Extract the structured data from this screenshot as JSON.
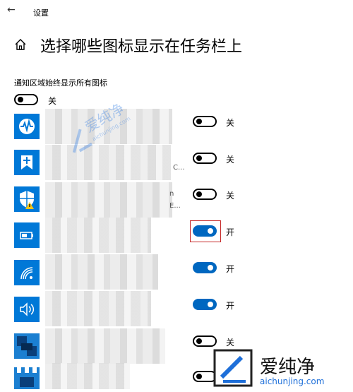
{
  "window": {
    "title": "设置",
    "back_icon": "back-arrow-icon"
  },
  "page": {
    "title": "选择哪些图标显示在任务栏上",
    "home_icon": "home-icon"
  },
  "always_show": {
    "label": "通知区域始终显示所有图标",
    "state": "关"
  },
  "apps": [
    {
      "icon": "activity-pulse-icon",
      "icon_color": "#0078d7",
      "state": "关",
      "on": false
    },
    {
      "icon": "bookmark-shield-icon",
      "icon_color": "#0078d7",
      "tail_text": "C...",
      "state": "关",
      "on": false
    },
    {
      "icon": "security-shield-warning-icon",
      "icon_color": "#0078d7",
      "tail_text": "n\nE...",
      "state": "关",
      "on": false
    },
    {
      "icon": "battery-icon",
      "icon_color": "#0078d7",
      "state": "开",
      "on": true
    },
    {
      "icon": "wifi-icon",
      "icon_color": "#0078d7",
      "state": "开",
      "on": true
    },
    {
      "icon": "volume-icon",
      "icon_color": "#0078d7",
      "state": "开",
      "on": true
    },
    {
      "icon": "app-tile-icon",
      "icon_color": "#0a5fa8",
      "state": "关",
      "on": false
    },
    {
      "icon": "app-tile-icon",
      "icon_color": "#0a5fa8",
      "state": "",
      "on": false
    }
  ],
  "watermark": {
    "name": "爱纯净",
    "url": "aichunjing.com"
  }
}
